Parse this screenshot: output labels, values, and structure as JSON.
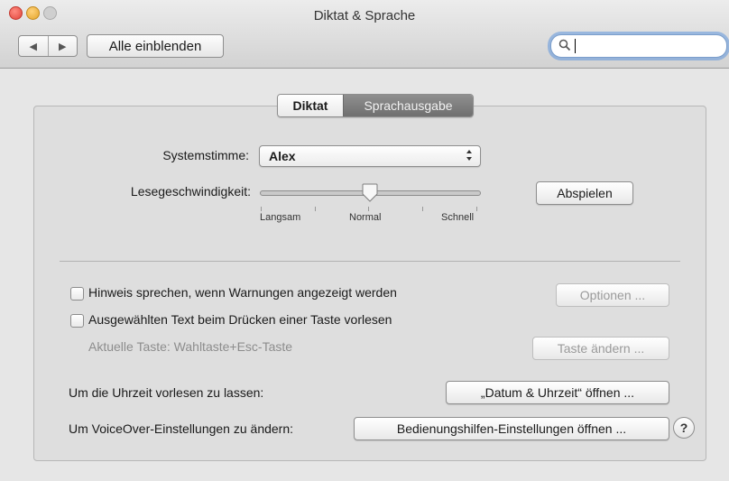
{
  "window": {
    "title": "Diktat & Sprache"
  },
  "toolbar": {
    "back_glyph": "◀",
    "forward_glyph": "▶",
    "show_all_label": "Alle einblenden",
    "search_value": "",
    "search_icon": "magnifier-icon"
  },
  "tabs": [
    {
      "label": "Diktat",
      "selected": false
    },
    {
      "label": "Sprachausgabe",
      "selected": true
    }
  ],
  "voice": {
    "label": "Systemstimme:",
    "value": "Alex"
  },
  "speed": {
    "label": "Lesegeschwindigkeit:",
    "position": 0.5,
    "tick_labels": [
      "Langsam",
      "Normal",
      "Schnell"
    ],
    "play_button": "Abspielen"
  },
  "options": {
    "warn_checkbox_label": "Hinweis sprechen, wenn Warnungen angezeigt werden",
    "warn_checked": false,
    "options_button": "Optionen ...",
    "read_text_checkbox_label": "Ausgewählten Text beim Drücken einer Taste vorlesen",
    "read_text_checked": false,
    "current_key_label": "Aktuelle Taste: Wahltaste+Esc-Taste",
    "change_key_button": "Taste ändern ..."
  },
  "links": {
    "time_label": "Um die Uhrzeit vorlesen zu lassen:",
    "time_button": "„Datum & Uhrzeit“ öffnen ...",
    "voiceover_label": "Um VoiceOver-Einstellungen zu ändern:",
    "voiceover_button": "Bedienungshilfen-Einstellungen öffnen ...",
    "help_glyph": "?"
  }
}
